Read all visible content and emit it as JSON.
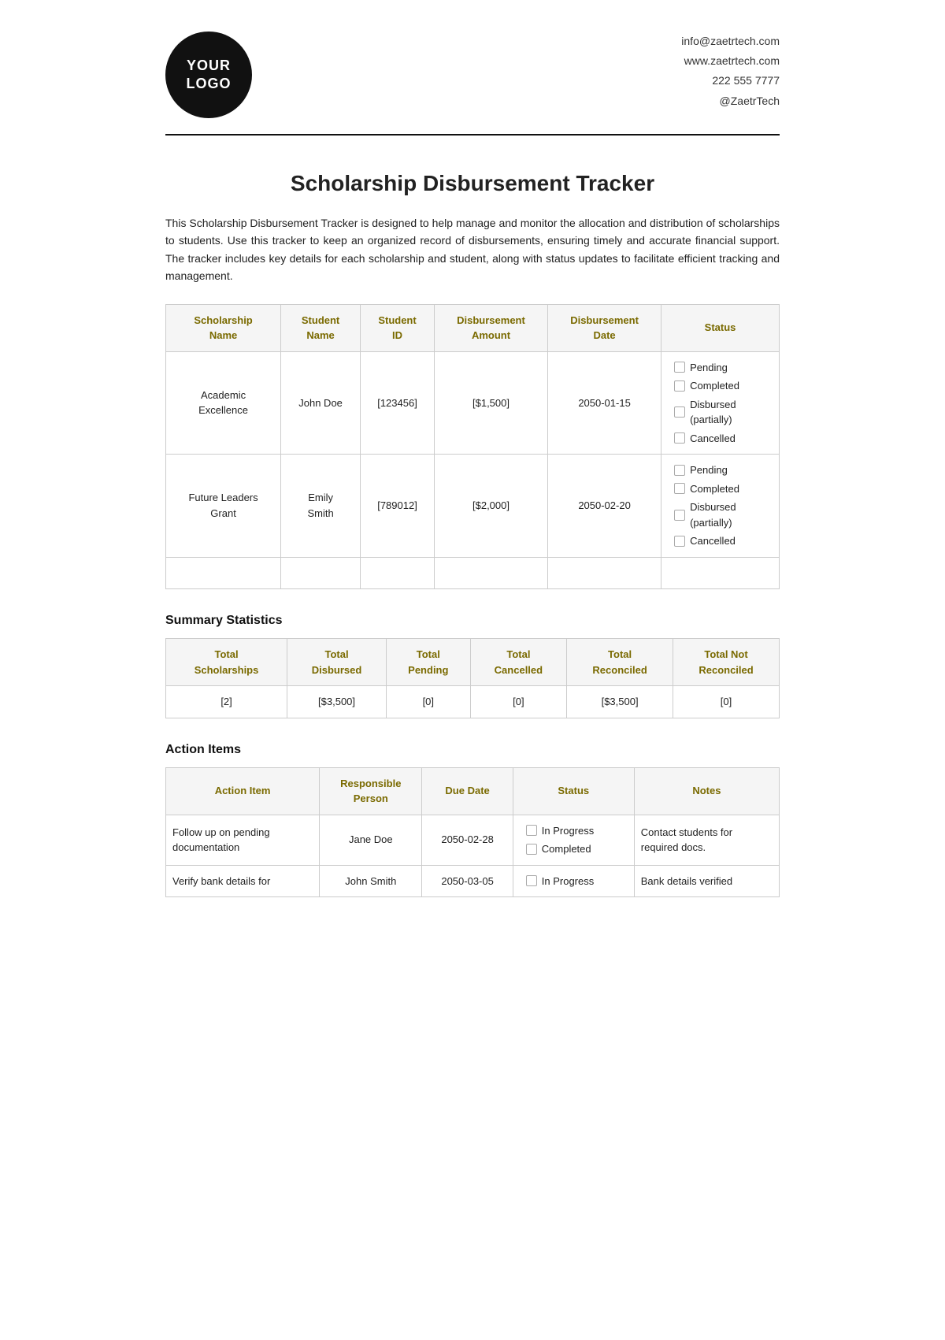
{
  "header": {
    "logo_line1": "YOUR",
    "logo_line2": "LOGO",
    "contact": {
      "email": "info@zaetrtech.com",
      "website": "www.zaetrtech.com",
      "phone": "222 555 7777",
      "social": "@ZaetrTech"
    }
  },
  "page": {
    "title": "Scholarship Disbursement Tracker",
    "description": "This Scholarship Disbursement Tracker is designed to help manage and monitor the allocation and distribution of scholarships to students. Use this tracker to keep an organized record of disbursements, ensuring timely and accurate financial support. The tracker includes key details for each scholarship and student, along with status updates to facilitate efficient tracking and management."
  },
  "main_table": {
    "headers": [
      "Scholarship Name",
      "Student Name",
      "Student ID",
      "Disbursement Amount",
      "Disbursement Date",
      "Status"
    ],
    "rows": [
      {
        "scholarship_name": "Academic Excellence",
        "student_name": "John Doe",
        "student_id": "[123456]",
        "amount": "[$1,500]",
        "date": "2050-01-15",
        "status_options": [
          "Pending",
          "Completed",
          "Disbursed (partially)",
          "Cancelled"
        ]
      },
      {
        "scholarship_name": "Future Leaders Grant",
        "student_name": "Emily Smith",
        "student_id": "[789012]",
        "amount": "[$2,000]",
        "date": "2050-02-20",
        "status_options": [
          "Pending",
          "Completed",
          "Disbursed (partially)",
          "Cancelled"
        ]
      }
    ]
  },
  "summary": {
    "title": "Summary Statistics",
    "headers": [
      "Total Scholarships",
      "Total Disbursed",
      "Total Pending",
      "Total Cancelled",
      "Total Reconciled",
      "Total Not Reconciled"
    ],
    "values": [
      "[2]",
      "[$3,500]",
      "[0]",
      "[0]",
      "[$3,500]",
      "[0]"
    ]
  },
  "action_items": {
    "title": "Action Items",
    "headers": [
      "Action Item",
      "Responsible Person",
      "Due Date",
      "Status",
      "Notes"
    ],
    "rows": [
      {
        "action": "Follow up on pending documentation",
        "person": "Jane Doe",
        "due_date": "2050-02-28",
        "status_options": [
          "In Progress",
          "Completed"
        ],
        "notes": "Contact students for required docs."
      },
      {
        "action": "Verify bank details for",
        "person": "John Smith",
        "due_date": "2050-03-05",
        "status_options": [
          "In Progress"
        ],
        "notes": "Bank details verified"
      }
    ]
  }
}
